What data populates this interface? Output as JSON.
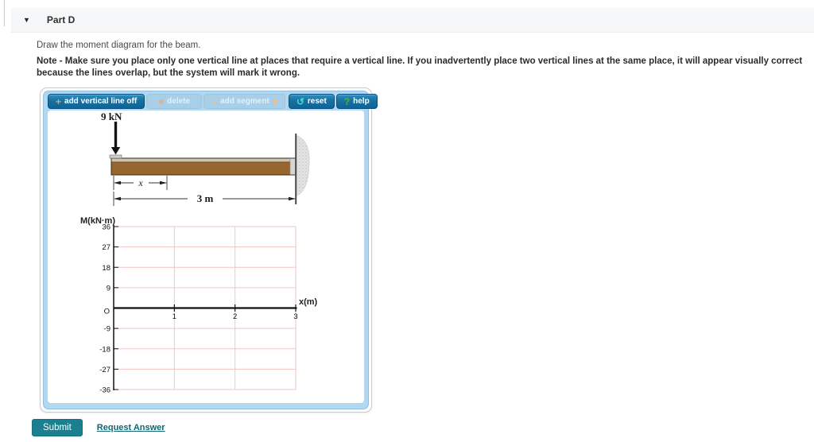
{
  "header": {
    "title": "Part D"
  },
  "icons": {
    "collapse": "▼",
    "add": "+",
    "delete": "×",
    "dropdown": "▾",
    "reset": "↺",
    "help": "?"
  },
  "instructions": {
    "prompt": "Draw the moment diagram for the beam.",
    "note": "Note - Make sure you place only one vertical line at places that require a vertical line. If you inadvertently place two vertical lines at the same place, it will appear visually correct because the lines overlap, but the system will mark it wrong."
  },
  "toolbar": {
    "add_vertical_line_label": "add vertical line off",
    "delete_label": "delete",
    "add_segment_label": "add segment",
    "reset_label": "reset",
    "help_label": "help"
  },
  "figure": {
    "force_label": "9 kN",
    "x_dim_label": "x",
    "length_label": "3 m"
  },
  "chart_data": {
    "type": "line",
    "title": "",
    "ylabel": "M(kN·m)",
    "xlabel": "x(m)",
    "origin_label": "O",
    "x_ticks": [
      1,
      2,
      3
    ],
    "y_ticks": [
      36,
      27,
      18,
      9,
      0,
      -9,
      -18,
      -27,
      -36
    ],
    "xlim": [
      0,
      3
    ],
    "ylim": [
      -36,
      36
    ],
    "grid": true,
    "legend": false,
    "series": []
  },
  "actions": {
    "submit_label": "Submit",
    "request_answer_label": "Request Answer"
  },
  "colors": {
    "accent_blue": "#1472a8",
    "panel_blue": "#b1d7f1",
    "disabled_blue": "#a9cfe8",
    "submit_teal": "#1a7f8e",
    "link_teal": "#0e6775",
    "grid_pink": "#f6c3c3",
    "axis_black": "#111111",
    "beam_brown": "#96662e",
    "icon_orange": "#e8a95f",
    "icon_cyan": "#45d8d8",
    "icon_green": "#49b53c"
  }
}
